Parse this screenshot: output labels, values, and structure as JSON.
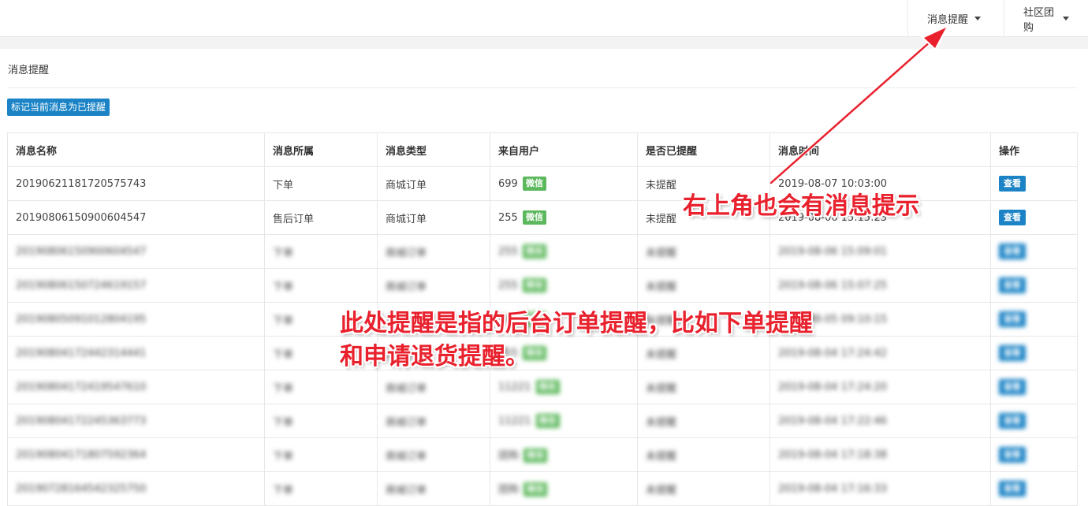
{
  "topnav": {
    "messages_label": "消息提醒",
    "group_buy_label": "社区团购"
  },
  "panel": {
    "title": "消息提醒",
    "mark_read_button": "标记当前消息为已提醒"
  },
  "table": {
    "headers": [
      "消息名称",
      "消息所属",
      "消息类型",
      "来自用户",
      "是否已提醒",
      "消息时间",
      "操作"
    ],
    "rows": [
      {
        "name": "20190621181720575743",
        "belongs": "下单",
        "type": "商城订单",
        "user": "699",
        "badge": "微信",
        "reminded": "未提醒",
        "time": "2019-08-07 10:03:00",
        "action": "查看"
      },
      {
        "name": "20190806150900604547",
        "belongs": "售后订单",
        "type": "商城订单",
        "user": "255",
        "badge": "微信",
        "reminded": "未提醒",
        "time": "2019-08-06 15:15:23",
        "action": "查看"
      },
      {
        "name": "20190806150900604547",
        "belongs": "下单",
        "type": "商城订单",
        "user": "255",
        "badge": "微信",
        "reminded": "未提醒",
        "time": "2019-08-06 15:09:01",
        "action": "查看"
      },
      {
        "name": "20190806150724619157",
        "belongs": "下单",
        "type": "商城订单",
        "user": "255",
        "badge": "微信",
        "reminded": "未提醒",
        "time": "2019-08-06 15:07:25",
        "action": "查看"
      },
      {
        "name": "20190805091012804195",
        "belongs": "下单",
        "type": "商城订单",
        "user": "255",
        "badge": "微信",
        "reminded": "未提醒",
        "time": "2019-08-05 09:10:15",
        "action": "查看"
      },
      {
        "name": "20190804172442314441",
        "belongs": "下单",
        "type": "商城订单",
        "user": "255",
        "badge": "微信",
        "reminded": "未提醒",
        "time": "2019-08-04 17:24:42",
        "action": "查看"
      },
      {
        "name": "20190804172419547610",
        "belongs": "下单",
        "type": "商城订单",
        "user": "11221",
        "badge": "微信",
        "reminded": "未提醒",
        "time": "2019-08-04 17:24:20",
        "action": "查看"
      },
      {
        "name": "20190804172245363773",
        "belongs": "下单",
        "type": "商城订单",
        "user": "11221",
        "badge": "微信",
        "reminded": "未提醒",
        "time": "2019-08-04 17:22:46",
        "action": "查看"
      },
      {
        "name": "20190804171807592364",
        "belongs": "下单",
        "type": "商城订单",
        "user": "团购",
        "badge": "微信",
        "reminded": "未提醒",
        "time": "2019-08-04 17:18:38",
        "action": "查看"
      },
      {
        "name": "20190728164542325750",
        "belongs": "下单",
        "type": "商城订单",
        "user": "团购",
        "badge": "微信",
        "reminded": "未提醒",
        "time": "2019-08-04 17:16:33",
        "action": "查看"
      }
    ]
  },
  "annotations": {
    "top_right_note": "右上角也会有消息提示",
    "center_note_line1": "此处提醒是指的后台订单提醒，比如下单提醒",
    "center_note_line2": "和申请退货提醒。"
  },
  "colors": {
    "primary": "#1c84c6",
    "wechat_badge": "#5cb85c",
    "annotation": "#e8212d"
  }
}
